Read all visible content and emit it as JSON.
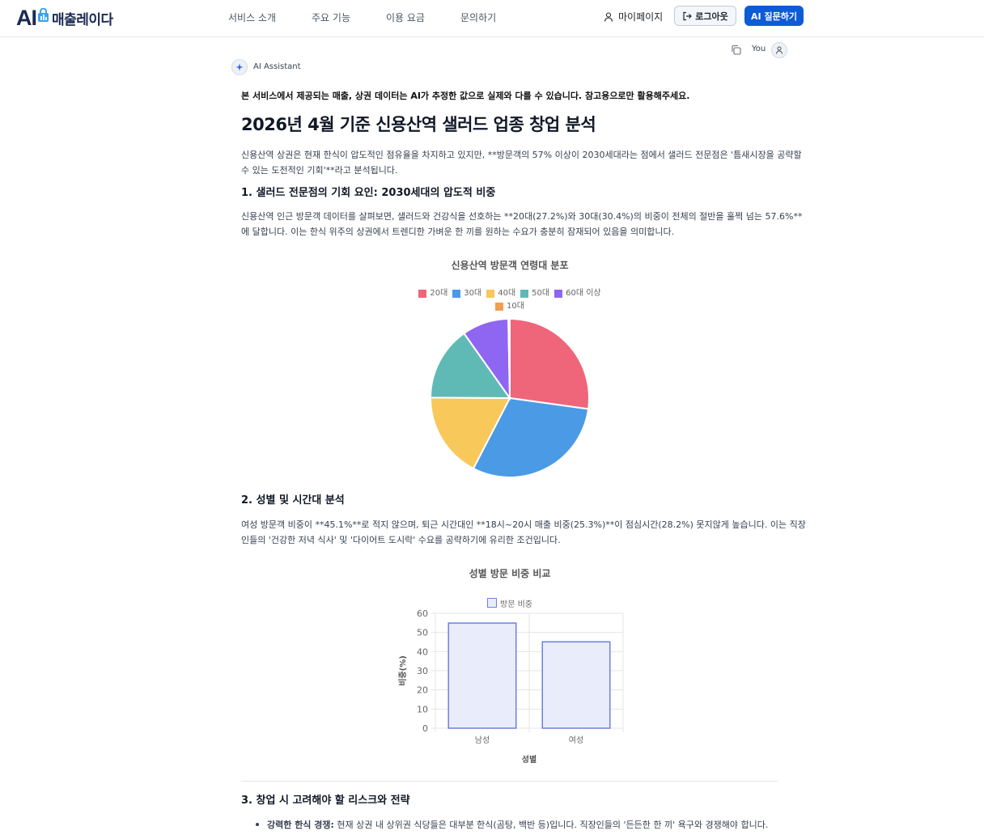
{
  "header": {
    "logo_ai": "AI",
    "logo_text": "매출레이다",
    "nav": [
      "서비스 소개",
      "주요 기능",
      "이용 요금",
      "문의하기"
    ],
    "mypage": "마이페이지",
    "logout": "로그아웃",
    "ask": "AI 질문하기",
    "icons": {
      "mypage": "user-icon",
      "logout": "logout-icon"
    }
  },
  "user": {
    "label": "You",
    "icons": {
      "copy": "copy-icon",
      "avatar": "user-avatar-icon"
    }
  },
  "assistant": {
    "label": "AI Assistant",
    "disclaimer": "본 서비스에서 제공되는 매출, 상권 데이터는 AI가 추정한 값으로 실제와 다를 수 있습니다. 참고용으로만 활용해주세요.",
    "title": "2026년 4월 기준 신용산역 샐러드 업종 창업 분석",
    "intro_1": "신용산역 상권은 현재 한식이 압도적인 점유율을 차지하고 있지만, **방문객의 57% 이상이 2030세대라는 점에서 샐러드 전문점은 '틈새시장을 공략할",
    "intro_2": "수 있는 도전적인 기회'**라고 분석됩니다.",
    "section1_title": "1. 샐러드 전문점의 기회 요인: 2030세대의 압도적 비중",
    "section1_p1": "신용산역 인근 방문객 데이터를 살펴보면, 샐러드와 건강식을 선호하는 **20대(27.2%)와 30대(30.4%)의 비중이 전체의 절반을 훌쩍 넘는 57.6%**",
    "section1_p2": "에 달합니다. 이는 한식 위주의 상권에서 트렌디한 가벼운 한 끼를 원하는 수요가 충분히 잠재되어 있음을 의미합니다.",
    "section2_title": "2. 성별 및 시간대 분석",
    "section2_p1": "여성 방문객 비중이 **45.1%**로 적지 않으며, 퇴근 시간대인 **18시~20시 매출 비중(25.3%)**이 점심시간(28.2%) 못지않게 높습니다. 이는 직장",
    "section2_p2": "인들의 '건강한 저녁 식사' 및 '다이어트 도시락' 수요를 공략하기에 유리한 조건입니다.",
    "section3_title": "3. 창업 시 고려해야 할 리스크와 전략",
    "bullet1_strong": "강력한 한식 경쟁:",
    "bullet1_text": " 현재 상권 내 상위권 식당들은 대부분 한식(곰탕, 백반 등)입니다. 직장인들의 '든든한 한 끼' 욕구와 경쟁해야 합니다."
  },
  "chart_data": [
    {
      "type": "pie",
      "title": "신용산역 방문객 연령대 분포",
      "legend_position": "top",
      "categories": [
        "20대",
        "30대",
        "40대",
        "50대",
        "60대 이상",
        "10대"
      ],
      "values": [
        27.2,
        30.4,
        17.5,
        15.1,
        9.5,
        0.3
      ],
      "colors": [
        "#ef6579",
        "#4a9ae6",
        "#f8c85b",
        "#5fbab6",
        "#8f66f2",
        "#f29e4c"
      ]
    },
    {
      "type": "bar",
      "title": "성별 방문 비중 비교",
      "legend_position": "top",
      "categories": [
        "남성",
        "여성"
      ],
      "series": [
        {
          "name": "방문 비중",
          "values": [
            54.9,
            45.1
          ]
        }
      ],
      "xlabel": "성별",
      "ylabel": "비중(%)",
      "ylim": [
        0,
        60
      ],
      "yticks": [
        "0",
        "10",
        "20",
        "30",
        "40",
        "50",
        "60"
      ],
      "colors": {
        "fill": "#e9ecfa",
        "stroke": "#6b80e6"
      },
      "grid": true
    }
  ]
}
